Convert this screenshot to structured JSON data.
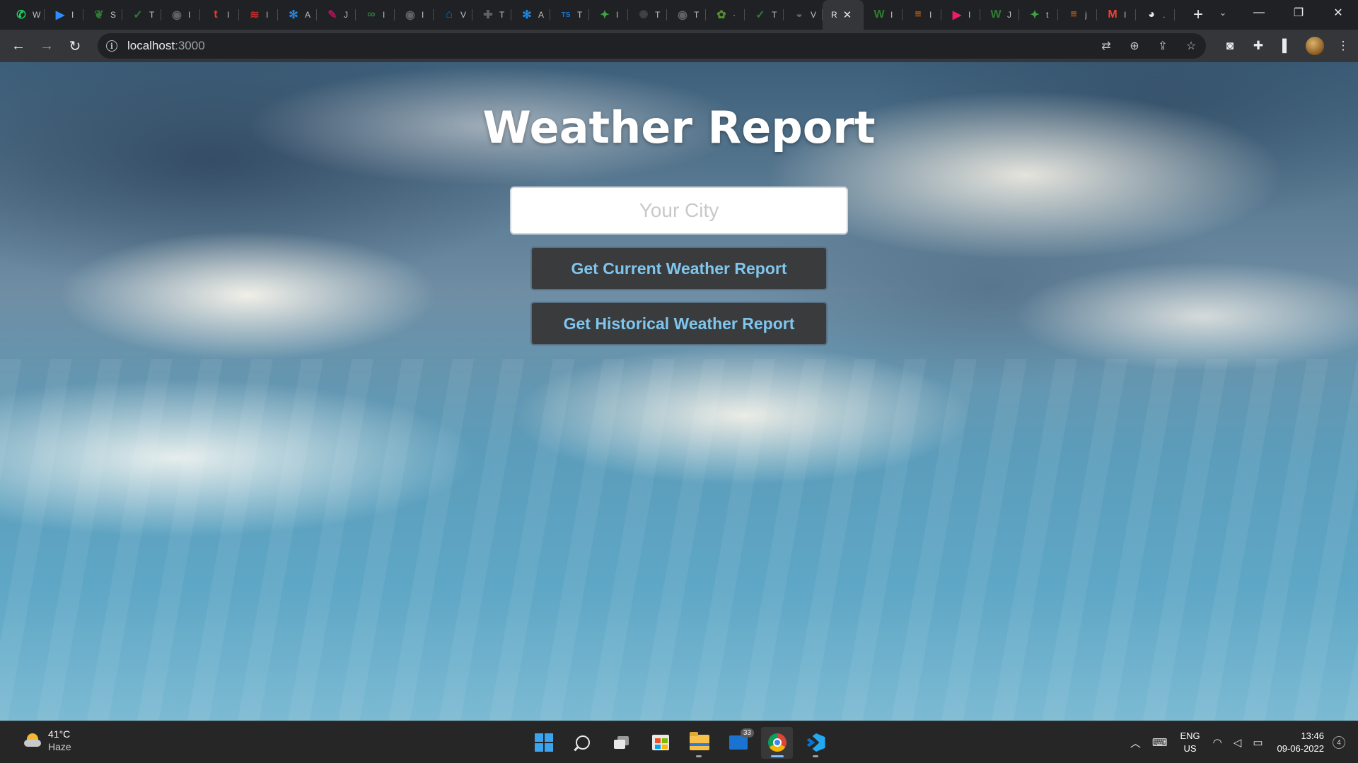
{
  "browser": {
    "tabs": [
      {
        "icon": "whatsapp-icon",
        "glyph": "✆",
        "color": "#25d366",
        "label": "W"
      },
      {
        "icon": "zoom-icon",
        "glyph": "▶",
        "color": "#2d8cff",
        "label": "I"
      },
      {
        "icon": "leaf-icon",
        "glyph": "❦",
        "color": "#2e7d32",
        "label": "S"
      },
      {
        "icon": "sprout-icon",
        "glyph": "✓",
        "color": "#2e7d32",
        "label": "T"
      },
      {
        "icon": "globe-icon",
        "glyph": "◉",
        "color": "#5f6368",
        "label": "I"
      },
      {
        "icon": "trello-t-icon",
        "glyph": "t",
        "color": "#e53935",
        "label": "I"
      },
      {
        "icon": "chart-icon",
        "glyph": "≋",
        "color": "#c62828",
        "label": "I"
      },
      {
        "icon": "snowflake-icon",
        "glyph": "✻",
        "color": "#1e88e5",
        "label": "A"
      },
      {
        "icon": "pen-icon",
        "glyph": "✎",
        "color": "#ad1457",
        "label": "J"
      },
      {
        "icon": "infinity-icon",
        "glyph": "∞",
        "color": "#2e7d32",
        "label": "I"
      },
      {
        "icon": "globe-icon",
        "glyph": "◉",
        "color": "#5f6368",
        "label": "I"
      },
      {
        "icon": "bank-icon",
        "glyph": "⌂",
        "color": "#0277bd",
        "label": "V"
      },
      {
        "icon": "plus-box-icon",
        "glyph": "✚",
        "color": "#616161",
        "label": "T"
      },
      {
        "icon": "snowflake-icon",
        "glyph": "✻",
        "color": "#1e88e5",
        "label": "A"
      },
      {
        "icon": "typescript-icon",
        "glyph": "TS",
        "color": "#1976d2",
        "label": "T"
      },
      {
        "icon": "sparkle-icon",
        "glyph": "✦",
        "color": "#43a047",
        "label": "I"
      },
      {
        "icon": "chatgpt-icon",
        "glyph": "✺",
        "color": "#424242",
        "label": "T"
      },
      {
        "icon": "globe-icon",
        "glyph": "◉",
        "color": "#5f6368",
        "label": "T"
      },
      {
        "icon": "spark-icon",
        "glyph": "✿",
        "color": "#558b2f",
        "label": "·"
      },
      {
        "icon": "sprout-icon",
        "glyph": "✓",
        "color": "#2e7d32",
        "label": "T"
      },
      {
        "icon": "car-icon",
        "glyph": "◒",
        "color": "#5f6368",
        "label": "V"
      },
      {
        "icon": "react-icon",
        "glyph": "",
        "color": "#35363a",
        "label": "R",
        "active": true
      },
      {
        "icon": "w-icon",
        "glyph": "W",
        "color": "#2e7d32",
        "label": "I"
      },
      {
        "icon": "stack-icon",
        "glyph": "≡",
        "color": "#ef6c00",
        "label": "I"
      },
      {
        "icon": "play-icon",
        "glyph": "▶",
        "color": "#e91e63",
        "label": "I"
      },
      {
        "icon": "w-icon",
        "glyph": "W",
        "color": "#2e7d32",
        "label": "J"
      },
      {
        "icon": "sparkle-icon",
        "glyph": "✦",
        "color": "#43a047",
        "label": "t"
      },
      {
        "icon": "stack-icon",
        "glyph": "≡",
        "color": "#ef6c00",
        "label": "j"
      },
      {
        "icon": "gmail-icon",
        "glyph": "M",
        "color": "#ea4335",
        "label": "I"
      },
      {
        "icon": "github-icon",
        "glyph": "◕",
        "color": "#e8eaed",
        "label": "."
      }
    ],
    "url_host": "localhost",
    "url_port": ":3000"
  },
  "page": {
    "title": "Weather Report",
    "city_placeholder": "Your City",
    "city_value": "",
    "current_button": "Get Current Weather Report",
    "historical_button": "Get Historical Weather Report"
  },
  "taskbar": {
    "weather_temp": "41°C",
    "weather_condition": "Haze",
    "mail_badge": "33",
    "lang_top": "ENG",
    "lang_bottom": "US",
    "time": "13:46",
    "date": "09-06-2022",
    "notifications": "4"
  }
}
